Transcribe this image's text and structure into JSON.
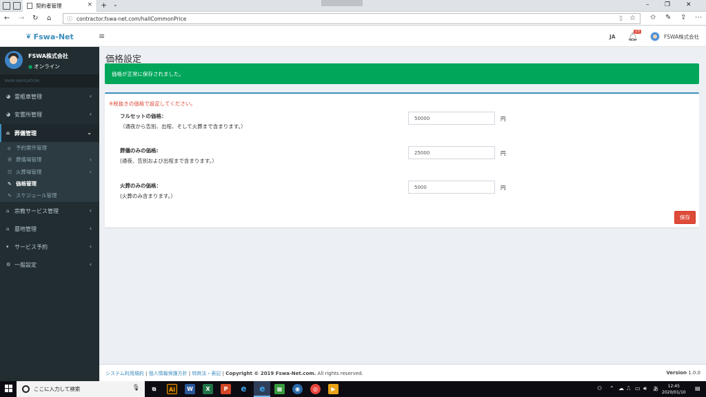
{
  "browser": {
    "tab_title": "契約者管理",
    "url": "contractor.fswa-net.com/hallCommonPrice"
  },
  "header": {
    "logo": "Fswa-Net",
    "lang": "JA",
    "notif_count": "23",
    "user": "FSWA株式会社"
  },
  "sidebar": {
    "company": "FSWA株式会社",
    "status": "オンライン",
    "section": "MAIN NAVIGATION",
    "items": [
      {
        "label": "霊柩車管理"
      },
      {
        "label": "安置所管理"
      },
      {
        "label": "葬儀管理"
      }
    ],
    "sub": [
      {
        "label": "予約案件管理"
      },
      {
        "label": "葬儀場管理"
      },
      {
        "label": "火葬場管理"
      },
      {
        "label": "価格管理"
      },
      {
        "label": "スケジュール管理"
      }
    ],
    "items2": [
      {
        "label": "宗教サービス管理"
      },
      {
        "label": "墓地管理"
      },
      {
        "label": "サービス予約"
      },
      {
        "label": "一般設定"
      }
    ]
  },
  "page": {
    "title": "価格設定",
    "alert": "価格が正常に保存されました。",
    "note": "※税抜きの価格で設定してください。",
    "unit": "円",
    "save": "保存",
    "fields": [
      {
        "label": "フルセットの価格：",
        "desc": "（通夜から告別、出棺、そして火葬まで含まります。）",
        "value": "50000"
      },
      {
        "label": "葬儀のみの価格:",
        "desc": "(通夜、告別および出棺まで含まります。）",
        "value": "25000"
      },
      {
        "label": "火葬のみの価格：",
        "desc": "(火葬のみ含まります。）",
        "value": "5000"
      }
    ]
  },
  "footer": {
    "link1": "システム利用規約",
    "link2": "個人情報保護方針",
    "link3": "特商法・表記",
    "copyright": "Copyright © 2019 Fswa-Net.com.",
    "rights": "All rights reserved.",
    "version_label": "Version",
    "version": "1.0.0"
  },
  "taskbar": {
    "search_placeholder": "ここに入力して検索",
    "time": "12:45",
    "date": "2020/01/10"
  }
}
